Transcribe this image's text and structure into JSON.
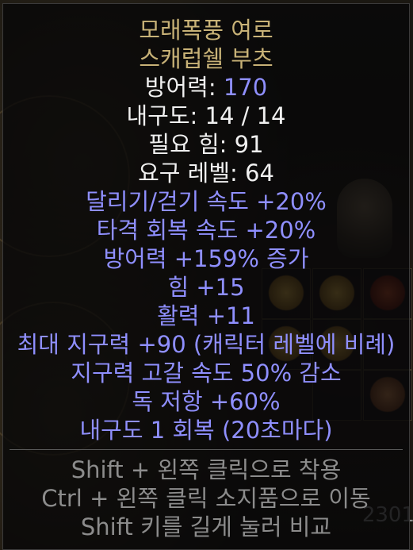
{
  "item": {
    "name_line1": "모래폭풍 여로",
    "name_line2": "스캐럽쉘 부츠",
    "armour_label": "방어력: ",
    "armour_value": "170",
    "durability": "내구도: 14 / 14",
    "requirement_str": "필요 힘: 91",
    "requirement_level": "요구 레벨: 64",
    "mods": [
      "달리기/걷기 속도 +20%",
      "타격 회복 속도 +20%",
      "방어력 +159% 증가",
      "힘 +15",
      "활력 +11",
      "최대 지구력 +90 (캐릭터 레벨에 비례)",
      "지구력 고갈 속도 50% 감소",
      "독 저항 +60%",
      "내구도 1 회복 (20초마다)"
    ]
  },
  "hints": [
    "Shift + 왼쪽 클릭으로 착용",
    "Ctrl + 왼쪽 클릭 소지품으로 이동",
    "Shift 키를 길게 눌러 비교"
  ],
  "background": {
    "gold_count_partial": "2301"
  },
  "colors": {
    "unique_gold": "#c8b277",
    "magic_blue": "#8f8fff",
    "base_white": "#f0f0f0",
    "hint_grey": "#8c8c8c"
  }
}
